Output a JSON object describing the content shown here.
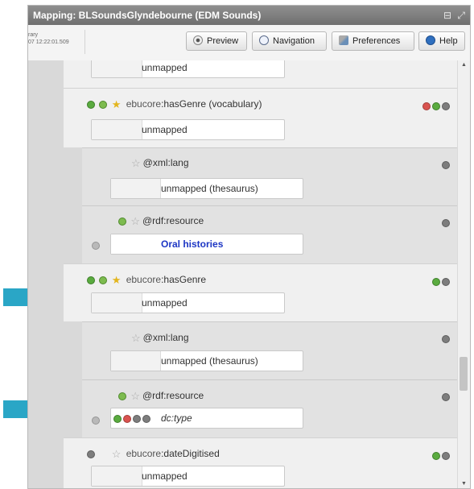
{
  "window": {
    "title": "Mapping: BLSoundsGlyndebourne (EDM Sounds)",
    "controls": "⊟ ⤢"
  },
  "toolbar": {
    "info_line1": "rary",
    "info_line2": "07 12:22:01.509",
    "preview_label": "Preview",
    "navigation_label": "Navigation",
    "preferences_label": "Preferences",
    "help_label": "Help"
  },
  "rows": {
    "r0": {
      "value": "unmapped"
    },
    "r1": {
      "prefix": "ebucore",
      "name": ":hasGenre (vocabulary)",
      "value": "unmapped"
    },
    "r2": {
      "name": "@xml:lang",
      "value": "unmapped (thesaurus)"
    },
    "r3": {
      "name": "@rdf:resource",
      "value": "Oral histories"
    },
    "r4": {
      "prefix": "ebucore",
      "name": ":hasGenre",
      "value": "unmapped"
    },
    "r5": {
      "name": "@xml:lang",
      "value": "unmapped (thesaurus)"
    },
    "r6": {
      "name": "@rdf:resource",
      "value": "dc:type"
    },
    "r7": {
      "prefix": "ebucore",
      "name": ":dateDigitised",
      "value": "unmapped"
    }
  },
  "colors": {
    "arrow": "#2aa6c6",
    "link": "#1d36c4"
  }
}
